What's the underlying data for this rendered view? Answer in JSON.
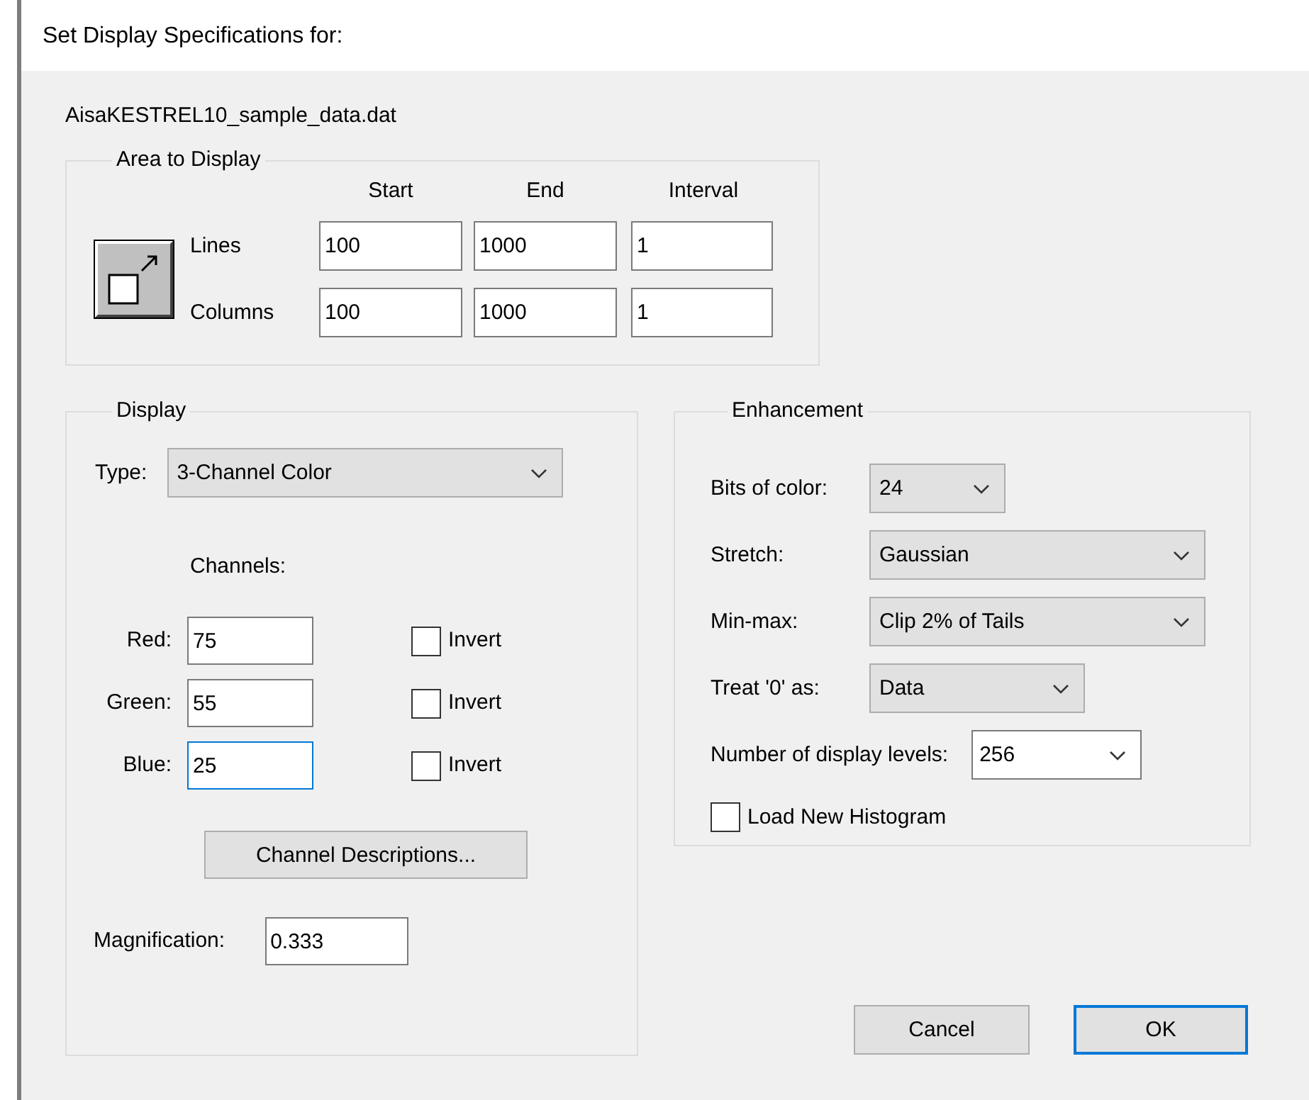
{
  "window": {
    "title": "Set Display Specifications for:"
  },
  "file_name": "AisaKESTREL10_sample_data.dat",
  "area": {
    "legend": "Area to Display",
    "columns": [
      "Start",
      "End",
      "Interval"
    ],
    "rows": [
      {
        "label": "Lines",
        "values": [
          "100",
          "1000",
          "1"
        ]
      },
      {
        "label": "Columns",
        "values": [
          "100",
          "1000",
          "1"
        ]
      }
    ]
  },
  "display": {
    "legend": "Display",
    "type": {
      "label": "Type:",
      "value": "3-Channel Color"
    },
    "channels_label": "Channels:",
    "channels": [
      {
        "label": "Red:",
        "value": "75",
        "focused": false,
        "invert": {
          "label": "Invert",
          "checked": false
        }
      },
      {
        "label": "Green:",
        "value": "55",
        "focused": false,
        "invert": {
          "label": "Invert",
          "checked": false
        }
      },
      {
        "label": "Blue:",
        "value": "25",
        "focused": true,
        "invert": {
          "label": "Invert",
          "checked": false
        }
      }
    ],
    "descriptions_button": "Channel Descriptions...",
    "magnification": {
      "label": "Magnification:",
      "value": "0.333"
    }
  },
  "enhancement": {
    "legend": "Enhancement",
    "settings": [
      {
        "label": "Bits of color:",
        "value": "24",
        "kind": "dropdown"
      },
      {
        "label": "Stretch:",
        "value": "Gaussian",
        "kind": "dropdown"
      },
      {
        "label": "Min-max:",
        "value": "Clip 2% of Tails",
        "kind": "dropdown"
      },
      {
        "label": "Treat '0' as:",
        "value": "Data",
        "kind": "dropdown"
      },
      {
        "label": "Number of display levels:",
        "value": "256",
        "kind": "combo"
      }
    ],
    "load_histogram": {
      "label": "Load New Histogram",
      "checked": false
    }
  },
  "buttons": [
    {
      "label": "Cancel",
      "default": false
    },
    {
      "label": "OK",
      "default": true
    }
  ]
}
